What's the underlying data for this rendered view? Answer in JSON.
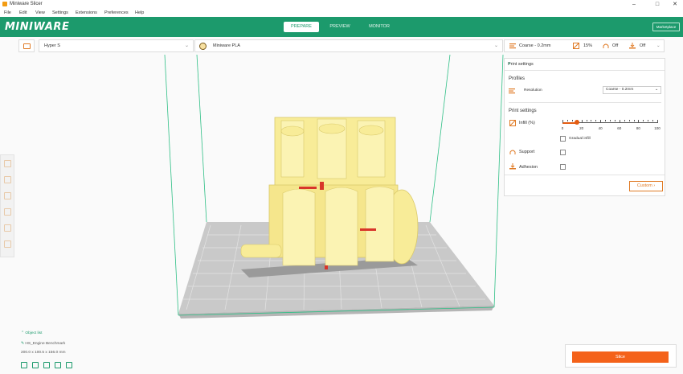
{
  "window": {
    "title": "Miniware Slicer",
    "controls": [
      "–",
      "□",
      "✕"
    ]
  },
  "menu": [
    "File",
    "Edit",
    "View",
    "Settings",
    "Extensions",
    "Preferences",
    "Help"
  ],
  "header": {
    "logo": "MINIWARE",
    "tabs": [
      "PREPARE",
      "PREVIEW",
      "MONITOR"
    ],
    "active_tab": "PREPARE",
    "marketplace": "Marketplace"
  },
  "toolbar": {
    "printer": "Hyper S",
    "material": "Miniware PLA",
    "summary": {
      "profile": "Coarse - 0.2mm",
      "infill": "15%",
      "support": "Off",
      "adhesion": "Off"
    }
  },
  "print_settings": {
    "title": "Print settings",
    "close": "×",
    "profiles_heading": "Profiles",
    "resolution_label": "Resolution",
    "resolution_value": "Coarse - 0.2mm",
    "settings_heading": "Print settings",
    "infill_label": "Infill (%)",
    "infill_value_percent": 15,
    "infill_ticks": [
      "0",
      "20",
      "40",
      "60",
      "80",
      "100"
    ],
    "gradual_infill_label": "Gradual infill",
    "support_label": "Support",
    "adhesion_label": "Adhesion",
    "custom_button": "Custom"
  },
  "object": {
    "list_label": "Object list",
    "name": "HS_Engine Benchmark",
    "dimensions": "200.0 x 100.5 x 156.0 mm"
  },
  "slice": {
    "button": "Slice"
  },
  "colors": {
    "brand_green": "#1c9a6c",
    "accent_orange": "#f4621a",
    "model_yellow": "#f8ec98",
    "model_red": "#d8352a"
  }
}
